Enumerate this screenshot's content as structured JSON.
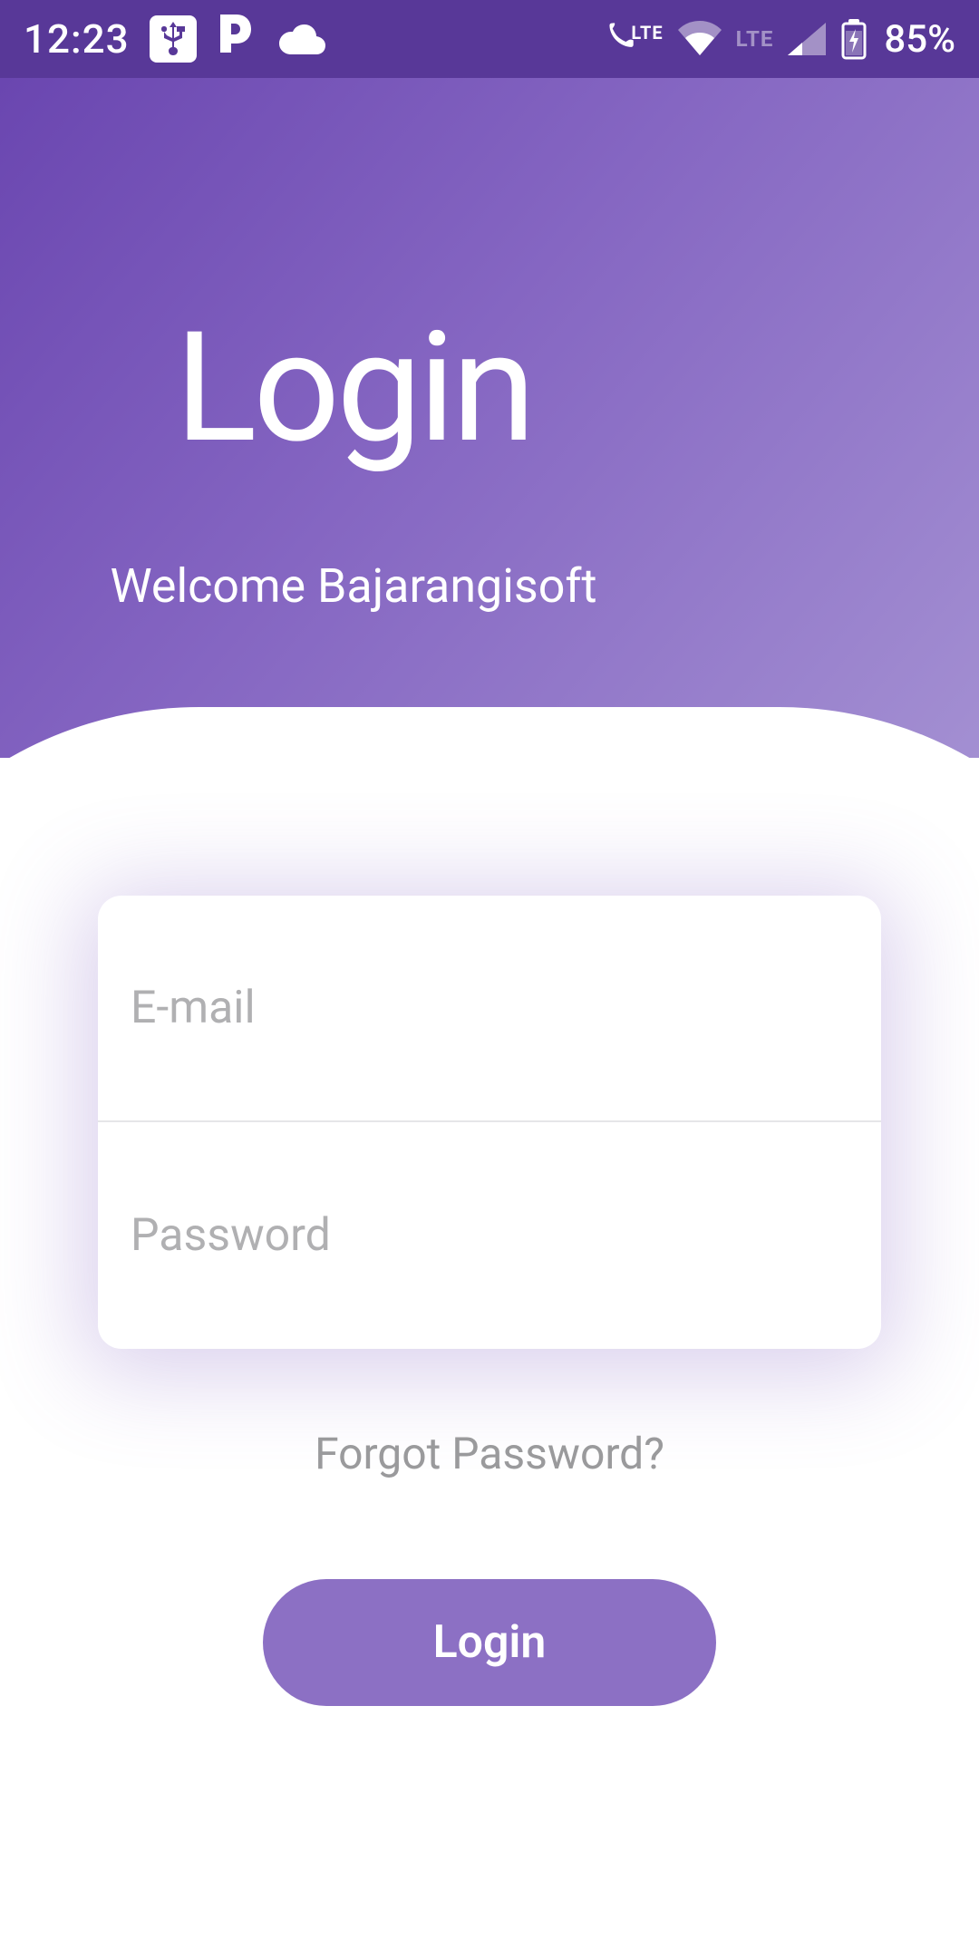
{
  "status_bar": {
    "time": "12:23",
    "battery": "85%",
    "lte_label": "LTE"
  },
  "header": {
    "title": "Login",
    "subtitle": "Welcome Bajarangisoft"
  },
  "form": {
    "email_placeholder": "E-mail",
    "email_value": "",
    "password_placeholder": "Password",
    "password_value": ""
  },
  "links": {
    "forgot_password": "Forgot Password?"
  },
  "buttons": {
    "login": "Login"
  },
  "colors": {
    "gradient_start": "#6a46b0",
    "gradient_end": "#a38fd2",
    "button_bg": "#8c70c4",
    "status_bar_bg": "#583898"
  }
}
